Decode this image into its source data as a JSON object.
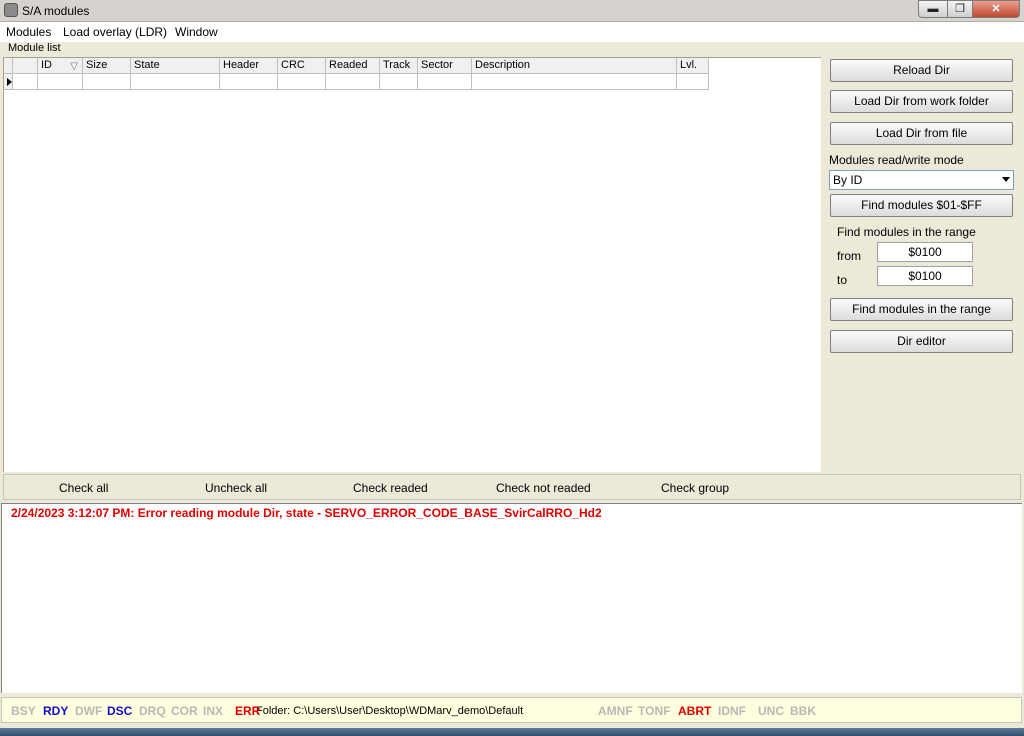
{
  "window": {
    "title": "S/A modules",
    "min_glyph": "▬",
    "max_glyph": "❐",
    "close_glyph": "✕"
  },
  "menu": {
    "items": [
      {
        "label": "Modules"
      },
      {
        "label": "Load overlay (LDR)"
      },
      {
        "label": "Window"
      }
    ]
  },
  "module_list": {
    "group_label": "Module list",
    "columns": [
      "ID",
      "Size",
      "State",
      "Header",
      "CRC",
      "Readed",
      "Track",
      "Sector",
      "Description",
      "Lvl."
    ],
    "sort_glyph": "▽",
    "rows": [
      [
        "",
        "",
        "",
        "",
        "",
        "",
        "",
        "",
        "",
        ""
      ]
    ]
  },
  "panel": {
    "reload_dir": "Reload Dir",
    "load_dir_work": "Load Dir from work folder",
    "load_dir_file": "Load Dir from file",
    "mode_label": "Modules read/write mode",
    "mode_value": "By ID",
    "find_all": "Find modules $01-$FF",
    "range_label": "Find modules in the range",
    "from_label": "from",
    "from_value": "$0100",
    "to_label": "to",
    "to_value": "$0100",
    "find_range": "Find modules in the range",
    "dir_editor": "Dir editor"
  },
  "check_bar": {
    "check_all": "Check all",
    "uncheck_all": "Uncheck all",
    "check_readed": "Check readed",
    "check_not_readed": "Check not readed",
    "check_group": "Check group"
  },
  "log": {
    "line1": "2/24/2023 3:12:07 PM: Error reading module Dir, state - SERVO_ERROR_CODE_BASE_SvirCalRRO_Hd2"
  },
  "status": {
    "flags_left": [
      {
        "label": "BSY",
        "state": "off"
      },
      {
        "label": "RDY",
        "state": "blue"
      },
      {
        "label": "DWF",
        "state": "off"
      },
      {
        "label": "DSC",
        "state": "blue"
      },
      {
        "label": "DRQ",
        "state": "off"
      },
      {
        "label": "COR",
        "state": "off"
      },
      {
        "label": "INX",
        "state": "off"
      },
      {
        "label": "ERR",
        "state": "red"
      }
    ],
    "folder": "Folder: C:\\Users\\User\\Desktop\\WDMarv_demo\\Default",
    "flags_right": [
      {
        "label": "AMNF",
        "state": "off"
      },
      {
        "label": "TONF",
        "state": "off"
      },
      {
        "label": "ABRT",
        "state": "red"
      },
      {
        "label": "IDNF",
        "state": "off"
      },
      {
        "label": "UNC",
        "state": "off"
      },
      {
        "label": "BBK",
        "state": "off"
      }
    ]
  },
  "colors": {
    "error_red": "#e00000",
    "flag_blue": "#1010c8",
    "flag_off": "#b8b8b8",
    "status_bg": "#ffffe0"
  }
}
